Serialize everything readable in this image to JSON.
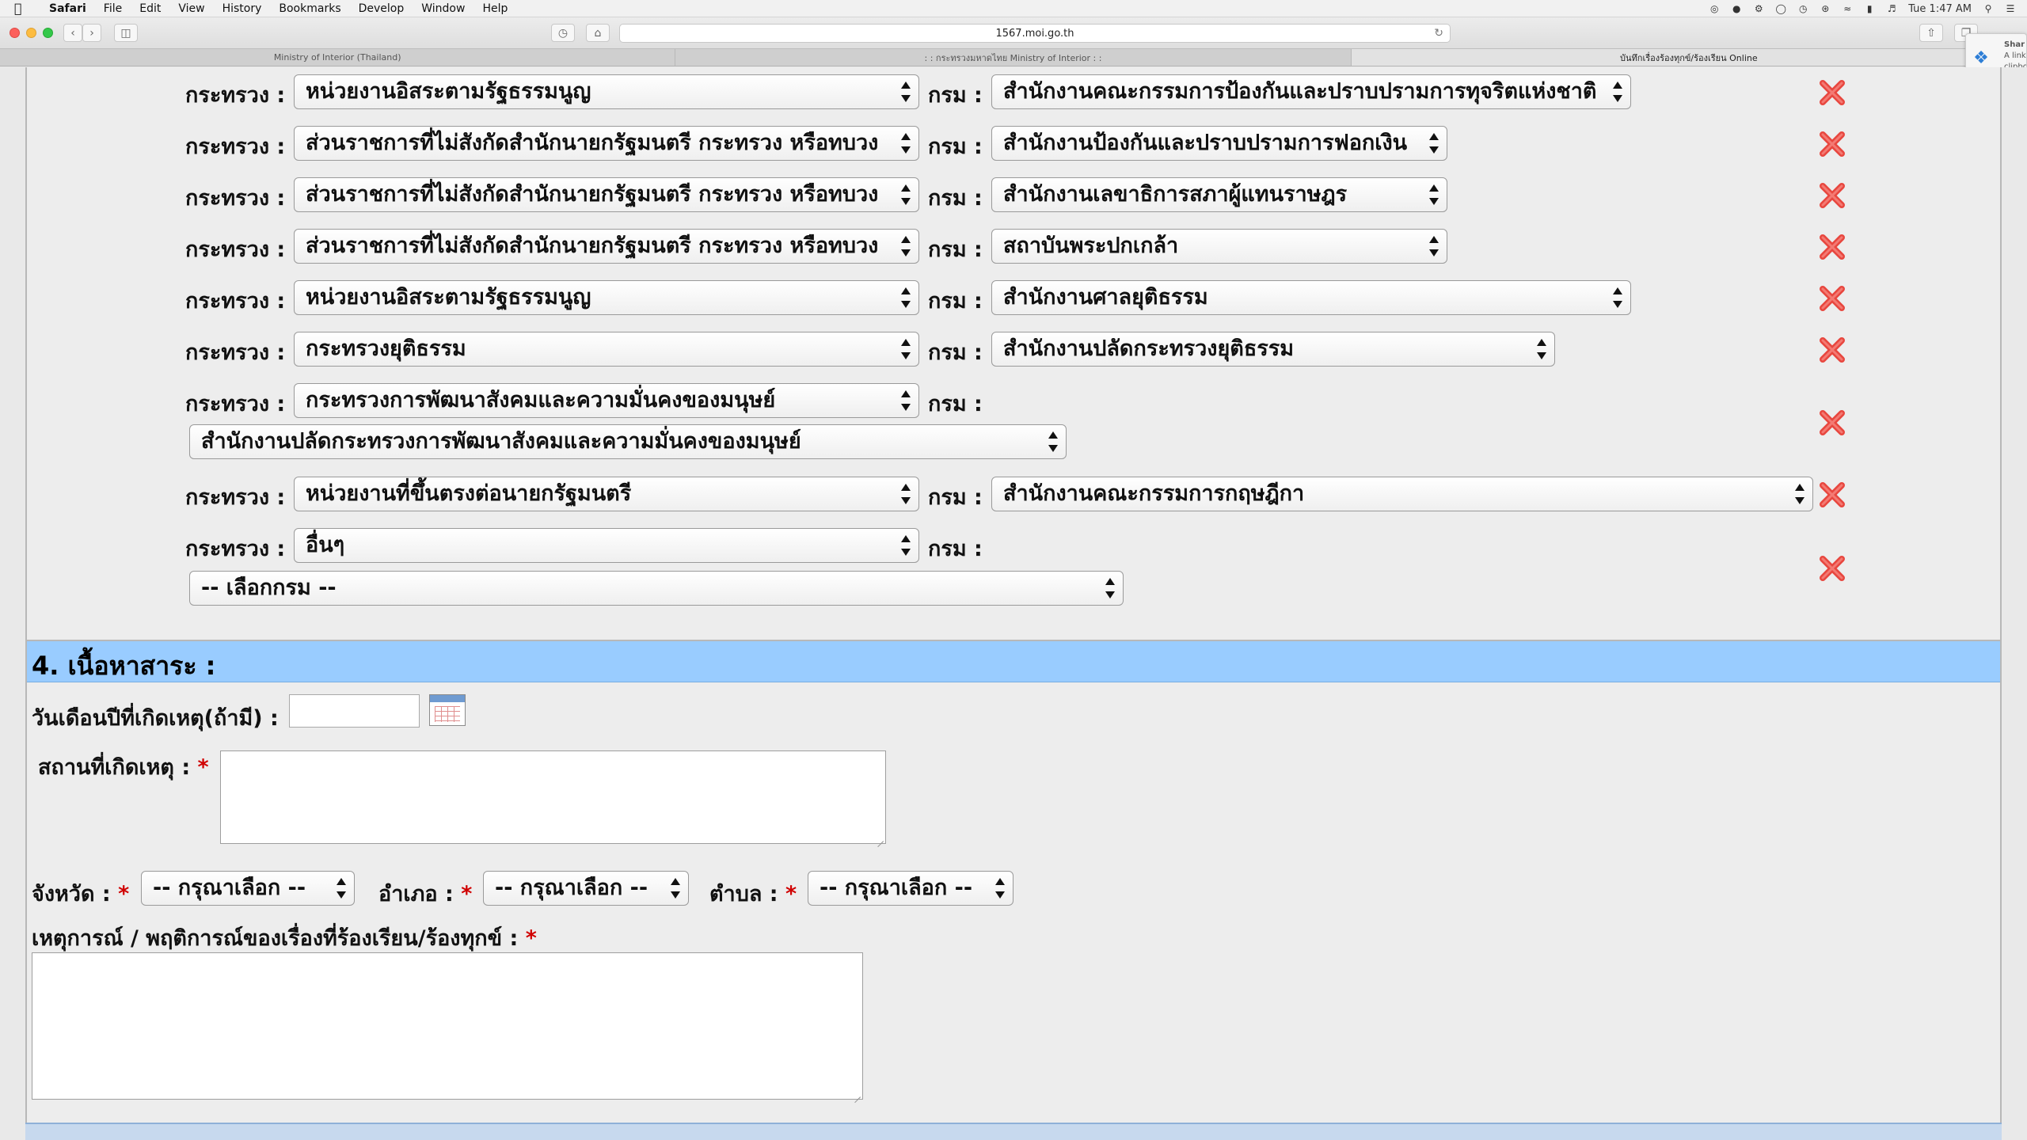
{
  "menubar": {
    "app": "Safari",
    "items": [
      "File",
      "Edit",
      "View",
      "History",
      "Bookmarks",
      "Develop",
      "Window",
      "Help"
    ],
    "clock": "Tue 1:47 AM"
  },
  "browser": {
    "url": "1567.moi.go.th",
    "tabs": [
      "Ministry of Interior (Thailand)",
      ": : กระทรวงมหาดไทย Ministry of Interior : :",
      "บันทึกเรื่องร้องทุกข์/ร้องเรียน Online"
    ],
    "share_notification": {
      "title": "Shar",
      "line1": "A link",
      "line2": "clipbo"
    }
  },
  "ministry_rows": [
    {
      "ministry_label": "กระทรวง :",
      "ministry": "หน่วยงานอิสระตามรัฐธรรมนูญ",
      "dept_label": "กรม :",
      "dept": "สำนักงานคณะกรรมการป้องกันและปราบปรามการทุจริตแห่งชาติ"
    },
    {
      "ministry_label": "กระทรวง :",
      "ministry": "ส่วนราชการที่ไม่สังกัดสำนักนายกรัฐมนตรี กระทรวง หรือทบวง",
      "dept_label": "กรม :",
      "dept": "สำนักงานป้องกันและปราบปรามการฟอกเงิน"
    },
    {
      "ministry_label": "กระทรวง :",
      "ministry": "ส่วนราชการที่ไม่สังกัดสำนักนายกรัฐมนตรี กระทรวง หรือทบวง",
      "dept_label": "กรม :",
      "dept": "สำนักงานเลขาธิการสภาผู้แทนราษฎร"
    },
    {
      "ministry_label": "กระทรวง :",
      "ministry": "ส่วนราชการที่ไม่สังกัดสำนักนายกรัฐมนตรี กระทรวง หรือทบวง",
      "dept_label": "กรม :",
      "dept": "สถาบันพระปกเกล้า"
    },
    {
      "ministry_label": "กระทรวง :",
      "ministry": "หน่วยงานอิสระตามรัฐธรรมนูญ",
      "dept_label": "กรม :",
      "dept": "สำนักงานศาลยุติธรรม"
    },
    {
      "ministry_label": "กระทรวง :",
      "ministry": "กระทรวงยุติธรรม",
      "dept_label": "กรม :",
      "dept": "สำนักงานปลัดกระทรวงยุติธรรม"
    },
    {
      "ministry_label": "กระทรวง :",
      "ministry": "กระทรวงการพัฒนาสังคมและความมั่นคงของมนุษย์",
      "dept_label": "กรม :",
      "dept": "สำนักงานปลัดกระทรวงการพัฒนาสังคมและความมั่นคงของมนุษย์"
    },
    {
      "ministry_label": "กระทรวง :",
      "ministry": "หน่วยงานที่ขึ้นตรงต่อนายกรัฐมนตรี",
      "dept_label": "กรม :",
      "dept": "สำนักงานคณะกรรมการกฤษฎีกา"
    },
    {
      "ministry_label": "กระทรวง :",
      "ministry": "อื่นๆ",
      "dept_label": "กรม :",
      "dept": "-- เลือกกรม --"
    }
  ],
  "section4": {
    "title": "4. เนื้อหาสาระ :",
    "date_label": "วันเดือนปีที่เกิดเหตุ(ถ้ามี) :",
    "date_value": "",
    "place_label": "สถานที่เกิดเหตุ :",
    "required_mark": "*",
    "province_label": "จังหวัด :",
    "province_value": "-- กรุณาเลือก --",
    "district_label": "อำเภอ :",
    "district_value": "-- กรุณาเลือก --",
    "subdistrict_label": "ตำบล :",
    "subdistrict_value": "-- กรุณาเลือก --",
    "event_label": "เหตุการณ์ / พฤติการณ์ของเรื่องที่ร้องเรียน/ร้องทุกข์ :"
  },
  "colors": {
    "section_header_bg": "#99ccff",
    "delete_icon": "#e8473f",
    "required": "#d00000"
  }
}
